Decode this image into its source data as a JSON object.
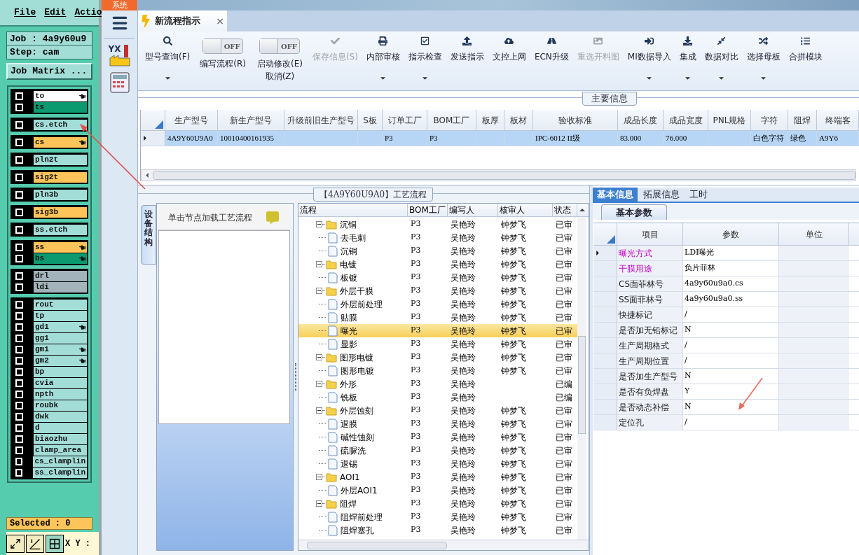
{
  "cam": {
    "menu": [
      "File",
      "Edit",
      "Actio"
    ],
    "job": "Job : 4a9y60u9",
    "step": "Step: cam",
    "matrix_button": "Job Matrix ...",
    "layer_groups": [
      [
        {
          "name": "to",
          "color": "#ffffff",
          "marked": true,
          "checked": false
        },
        {
          "name": "ts",
          "color": "#0b9a70",
          "marked": false,
          "checked": false
        }
      ],
      [
        {
          "name": "cs.etch",
          "color": "#a3ddd8",
          "marked": false,
          "checked": false
        }
      ],
      [
        {
          "name": "cs",
          "color": "#fdc45a",
          "marked": true,
          "checked": false
        }
      ],
      [
        {
          "name": "pln2t",
          "color": "#a3ddd8",
          "marked": false,
          "checked": false
        }
      ],
      [
        {
          "name": "sig2t",
          "color": "#fdc45a",
          "marked": false,
          "checked": false
        }
      ],
      [
        {
          "name": "pln3b",
          "color": "#a3ddd8",
          "marked": false,
          "checked": false
        }
      ],
      [
        {
          "name": "sig3b",
          "color": "#fdc45a",
          "marked": false,
          "checked": false
        }
      ],
      [
        {
          "name": "ss.etch",
          "color": "#a3ddd8",
          "marked": false,
          "checked": false
        }
      ],
      [
        {
          "name": "ss",
          "color": "#fdc45a",
          "marked": true,
          "checked": false
        },
        {
          "name": "bs",
          "color": "#0b9a70",
          "marked": true,
          "checked": false
        }
      ],
      [
        {
          "name": "drl",
          "color": "#a3b3bb",
          "marked": false,
          "checked": false
        },
        {
          "name": "ldi",
          "color": "#a3b3bb",
          "marked": false,
          "checked": false
        }
      ],
      [
        {
          "name": "rout",
          "color": "#a3ddd8",
          "marked": false,
          "checked": false
        },
        {
          "name": "tp",
          "color": "#a3ddd8",
          "marked": false,
          "checked": false
        },
        {
          "name": "gd1",
          "color": "#a3ddd8",
          "marked": true,
          "checked": false
        },
        {
          "name": "gg1",
          "color": "#a3ddd8",
          "marked": false,
          "checked": false
        },
        {
          "name": "gm1",
          "color": "#a3ddd8",
          "marked": true,
          "checked": false
        },
        {
          "name": "gm2",
          "color": "#a3ddd8",
          "marked": true,
          "checked": false
        },
        {
          "name": "bp",
          "color": "#a3ddd8",
          "marked": false,
          "checked": false
        },
        {
          "name": "cvia",
          "color": "#a3ddd8",
          "marked": false,
          "checked": false
        },
        {
          "name": "npth",
          "color": "#a3ddd8",
          "marked": false,
          "checked": false
        },
        {
          "name": "roubk",
          "color": "#a3ddd8",
          "marked": false,
          "checked": false
        },
        {
          "name": "dwk",
          "color": "#a3ddd8",
          "marked": false,
          "checked": false
        },
        {
          "name": "d",
          "color": "#a3ddd8",
          "marked": false,
          "checked": false
        },
        {
          "name": "biaozhu",
          "color": "#a3ddd8",
          "marked": false,
          "checked": false
        },
        {
          "name": "clamp_area",
          "color": "#a3ddd8",
          "marked": false,
          "checked": false
        },
        {
          "name": "cs_clamplin",
          "color": "#a3ddd8",
          "marked": false,
          "checked": false
        },
        {
          "name": "ss_clamplin",
          "color": "#a3ddd8",
          "marked": false,
          "checked": false
        }
      ]
    ],
    "selected_count": "Selected : 0",
    "coords": "X Y :"
  },
  "nav": {
    "system_tab": "系统",
    "logo_text": "YX"
  },
  "tab": {
    "title": "新流程指示",
    "close": "×"
  },
  "toolbar": [
    {
      "kind": "button",
      "label": "型号查询(F)",
      "dropdown": true,
      "disabled": false
    },
    {
      "kind": "toggle",
      "switch_text": "OFF",
      "on": false,
      "label": "编写流程(R)"
    },
    {
      "kind": "toggle",
      "switch_text": "OFF",
      "on": false,
      "label": "启动修改(E)",
      "sub_label": "取消(Z)"
    },
    {
      "kind": "button",
      "label": "保存信息(S)",
      "dropdown": false,
      "disabled": true
    },
    {
      "kind": "button",
      "label": "内部审核",
      "dropdown": true,
      "disabled": false
    },
    {
      "kind": "button",
      "label": "指示检查",
      "dropdown": true,
      "disabled": false
    },
    {
      "kind": "button",
      "label": "发送指示",
      "dropdown": false,
      "disabled": false
    },
    {
      "kind": "button",
      "label": "文控上网",
      "dropdown": false,
      "disabled": false
    },
    {
      "kind": "button",
      "label": "ECN升级",
      "dropdown": false,
      "disabled": false
    },
    {
      "kind": "button",
      "label": "重选开料图",
      "dropdown": false,
      "disabled": true
    },
    {
      "kind": "button",
      "label": "MI数据导入",
      "dropdown": true,
      "disabled": false
    },
    {
      "kind": "button",
      "label": "集成",
      "dropdown": true,
      "disabled": false
    },
    {
      "kind": "button",
      "label": "数据对比",
      "dropdown": true,
      "disabled": false
    },
    {
      "kind": "button",
      "label": "选择母板",
      "dropdown": true,
      "disabled": false
    },
    {
      "kind": "button",
      "label": "合拼模块",
      "dropdown": false,
      "disabled": false
    }
  ],
  "main_info": {
    "title": "主要信息",
    "columns": [
      "生产型号",
      "新生产型号",
      "升级前旧生产型号",
      "S板",
      "订单工厂",
      "BOM工厂",
      "板厚",
      "板材",
      "验收标准",
      "成品长度",
      "成品宽度",
      "PNL规格",
      "字符",
      "阻焊",
      "终端客"
    ],
    "rows": [
      {
        "selected": true,
        "cells": [
          "4A9Y60U9A0",
          "10010400161935",
          null,
          null,
          "P3",
          "P3",
          null,
          null,
          "IPC-6012 II级",
          "83.000",
          "76.000",
          null,
          "白色字符",
          "绿色",
          "A9Y6"
        ]
      }
    ]
  },
  "process": {
    "title": "【4A9Y60U9A0】工艺流程",
    "side_tab": "设备结构",
    "hint": "单击节点加载工艺流程",
    "columns": [
      "流程",
      "BOM工厂",
      "编写人",
      "核审人",
      "状态"
    ],
    "tree": [
      {
        "name": "沉铜",
        "bom": "P3",
        "writer": "吴艳玲",
        "reviewer": "钟梦飞",
        "status": "已审",
        "selected": false,
        "expanded": true,
        "children": [
          {
            "name": "去毛刺",
            "bom": "P3",
            "writer": "吴艳玲",
            "reviewer": "钟梦飞",
            "status": "已审",
            "selected": false
          },
          {
            "name": "沉铜",
            "bom": "P3",
            "writer": "吴艳玲",
            "reviewer": "钟梦飞",
            "status": "已审",
            "selected": false
          }
        ]
      },
      {
        "name": "电镀",
        "bom": "P3",
        "writer": "吴艳玲",
        "reviewer": "钟梦飞",
        "status": "已审",
        "selected": false,
        "expanded": true,
        "children": [
          {
            "name": "板镀",
            "bom": "P3",
            "writer": "吴艳玲",
            "reviewer": "钟梦飞",
            "status": "已审",
            "selected": false
          }
        ]
      },
      {
        "name": "外层干膜",
        "bom": "P3",
        "writer": "吴艳玲",
        "reviewer": "钟梦飞",
        "status": "已审",
        "selected": false,
        "expanded": true,
        "children": [
          {
            "name": "外层前处理",
            "bom": "P3",
            "writer": "吴艳玲",
            "reviewer": "钟梦飞",
            "status": "已审",
            "selected": false
          },
          {
            "name": "贴膜",
            "bom": "P3",
            "writer": "吴艳玲",
            "reviewer": "钟梦飞",
            "status": "已审",
            "selected": false
          },
          {
            "name": "曝光",
            "bom": "P3",
            "writer": "吴艳玲",
            "reviewer": "钟梦飞",
            "status": "已审",
            "selected": true
          },
          {
            "name": "显影",
            "bom": "P3",
            "writer": "吴艳玲",
            "reviewer": "钟梦飞",
            "status": "已审",
            "selected": false
          }
        ]
      },
      {
        "name": "图形电镀",
        "bom": "P3",
        "writer": "吴艳玲",
        "reviewer": "钟梦飞",
        "status": "已审",
        "selected": false,
        "expanded": true,
        "children": [
          {
            "name": "图形电镀",
            "bom": "P3",
            "writer": "吴艳玲",
            "reviewer": "钟梦飞",
            "status": "已审",
            "selected": false
          }
        ]
      },
      {
        "name": "外形",
        "bom": "P3",
        "writer": "吴艳玲",
        "status": "已编",
        "selected": false,
        "expanded": true,
        "children": [
          {
            "name": "铣板",
            "bom": "P3",
            "writer": "吴艳玲",
            "status": "已编",
            "selected": false
          }
        ]
      },
      {
        "name": "外层蚀刻",
        "bom": "P3",
        "writer": "吴艳玲",
        "reviewer": "钟梦飞",
        "status": "已审",
        "selected": false,
        "expanded": true,
        "children": [
          {
            "name": "退膜",
            "bom": "P3",
            "writer": "吴艳玲",
            "reviewer": "钟梦飞",
            "status": "已审",
            "selected": false
          },
          {
            "name": "碱性蚀刻",
            "bom": "P3",
            "writer": "吴艳玲",
            "reviewer": "钟梦飞",
            "status": "已审",
            "selected": false
          },
          {
            "name": "硫脲洗",
            "bom": "P3",
            "writer": "吴艳玲",
            "reviewer": "钟梦飞",
            "status": "已审",
            "selected": false
          },
          {
            "name": "退锡",
            "bom": "P3",
            "writer": "吴艳玲",
            "reviewer": "钟梦飞",
            "status": "已审",
            "selected": false
          }
        ]
      },
      {
        "name": "AOI1",
        "bom": "P3",
        "writer": "吴艳玲",
        "reviewer": "钟梦飞",
        "status": "已审",
        "selected": false,
        "expanded": true,
        "children": [
          {
            "name": "外层AOI1",
            "bom": "P3",
            "writer": "吴艳玲",
            "reviewer": "钟梦飞",
            "status": "已审",
            "selected": false
          }
        ]
      },
      {
        "name": "阻焊",
        "bom": "P3",
        "writer": "吴艳玲",
        "reviewer": "钟梦飞",
        "status": "已审",
        "selected": false,
        "expanded": true,
        "children": [
          {
            "name": "阻焊前处理",
            "bom": "P3",
            "writer": "吴艳玲",
            "reviewer": "钟梦飞",
            "status": "已审",
            "selected": false
          },
          {
            "name": "阻焊塞孔",
            "bom": "P3",
            "writer": "吴艳玲",
            "reviewer": "钟梦飞",
            "status": "已审",
            "selected": false
          }
        ]
      }
    ]
  },
  "details": {
    "tabs": [
      {
        "label": "基本信息",
        "selected": true
      },
      {
        "label": "拓展信息",
        "selected": false
      },
      {
        "label": "工时",
        "selected": false
      }
    ],
    "subtab": "基本参数",
    "columns": [
      "项目",
      "参数",
      "单位"
    ],
    "rows": [
      {
        "item": "曝光方式",
        "value": "LDI曝光",
        "highlighted": true,
        "selected": true
      },
      {
        "item": "干膜用途",
        "value": "负片菲林",
        "highlighted": true,
        "selected": false
      },
      {
        "item": "CS面菲林号",
        "value": "4a9y60u9a0.cs",
        "highlighted": false,
        "selected": false
      },
      {
        "item": "SS面菲林号",
        "value": "4a9y60u9a0.ss",
        "highlighted": false,
        "selected": false
      },
      {
        "item": "快捷标记",
        "value": "/",
        "highlighted": false,
        "selected": false
      },
      {
        "item": "是否加无铅标记",
        "value": "N",
        "highlighted": false,
        "selected": false
      },
      {
        "item": "生产周期格式",
        "value": "/",
        "highlighted": false,
        "selected": false
      },
      {
        "item": "生产周期位置",
        "value": "/",
        "highlighted": false,
        "selected": false
      },
      {
        "item": "是否加生产型号",
        "value": "N",
        "highlighted": false,
        "selected": false
      },
      {
        "item": "是否有负焊盘",
        "value": "Y",
        "highlighted": false,
        "selected": false
      },
      {
        "item": "是否动态补偿",
        "value": "N",
        "highlighted": false,
        "selected": false
      },
      {
        "item": "定位孔",
        "value": "/",
        "highlighted": false,
        "selected": false
      }
    ]
  }
}
